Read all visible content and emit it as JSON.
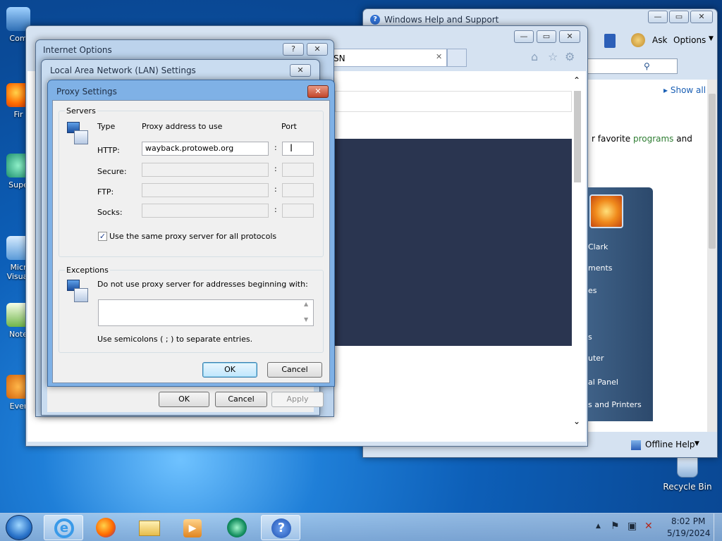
{
  "desktop": {
    "icons": [
      {
        "label": "Com"
      },
      {
        "label": "Fir"
      },
      {
        "label": "Supe"
      },
      {
        "label": "Micr Visual"
      },
      {
        "label": "Note"
      },
      {
        "label": "Ever"
      },
      {
        "label": "Recycle Bin"
      }
    ]
  },
  "help_window": {
    "title": "Windows Help and Support",
    "toolbar": {
      "ask": "Ask",
      "options": "Options"
    },
    "show_all": "Show all",
    "body_text_1": "r favorite ",
    "body_text_link": "programs",
    "body_text_2": " and",
    "offline_help": "Offline Help"
  },
  "ie_window": {
    "tab_fragment": "SN",
    "start_menu_items": [
      "Clark",
      "ments",
      "es",
      "s",
      "uter",
      "al Panel",
      "s and Printers"
    ]
  },
  "internet_options": {
    "title": "Internet Options"
  },
  "lan_settings": {
    "title": "Local Area Network (LAN) Settings",
    "ok": "OK",
    "cancel": "Cancel",
    "apply": "Apply"
  },
  "proxy_settings": {
    "title": "Proxy Settings",
    "servers_legend": "Servers",
    "col_type": "Type",
    "col_address": "Proxy address to use",
    "col_port": "Port",
    "rows": [
      {
        "type": "HTTP:",
        "address": "wayback.protoweb.org",
        "port": "",
        "enabled": true
      },
      {
        "type": "Secure:",
        "address": "",
        "port": "",
        "enabled": false
      },
      {
        "type": "FTP:",
        "address": "",
        "port": "",
        "enabled": false
      },
      {
        "type": "Socks:",
        "address": "",
        "port": "",
        "enabled": false
      }
    ],
    "colon": ":",
    "same_proxy_label": "Use the same proxy server for all protocols",
    "same_proxy_checked": true,
    "exceptions_legend": "Exceptions",
    "exceptions_label": "Do not use proxy server for addresses beginning with:",
    "exceptions_value": "",
    "semicolon_hint": "Use semicolons ( ; ) to separate entries.",
    "ok": "OK",
    "cancel": "Cancel"
  },
  "taskbar": {
    "time": "8:02 PM",
    "date": "5/19/2024"
  }
}
